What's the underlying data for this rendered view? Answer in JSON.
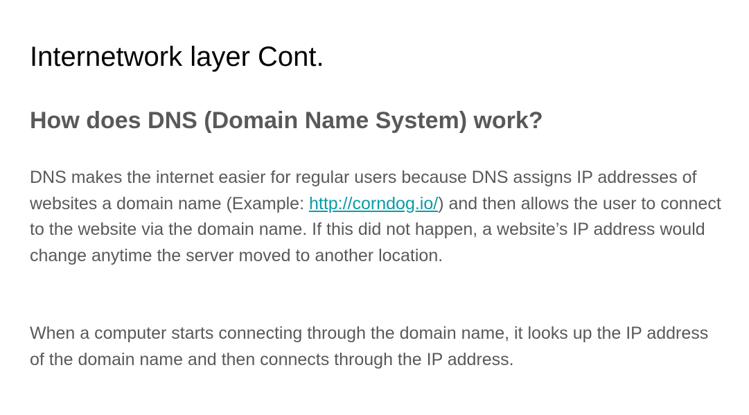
{
  "slide": {
    "title": "Internetwork layer Cont.",
    "subtitle": "How does DNS (Domain Name System) work?",
    "paragraph1": {
      "before_link": "DNS makes the internet easier for regular users because DNS assigns IP addresses of websites a domain name (Example: ",
      "link_text": "http://corndog.io/",
      "after_link": ") and then allows the user to connect to the website via the domain name. If this did not happen, a website’s IP address would change anytime the server moved to another location."
    },
    "paragraph2": "When a computer starts connecting through the domain name, it looks up the IP address of the domain name and then connects through the IP address.",
    "colors": {
      "title": "#000000",
      "text": "#595959",
      "link": "#0b9ba6"
    }
  }
}
